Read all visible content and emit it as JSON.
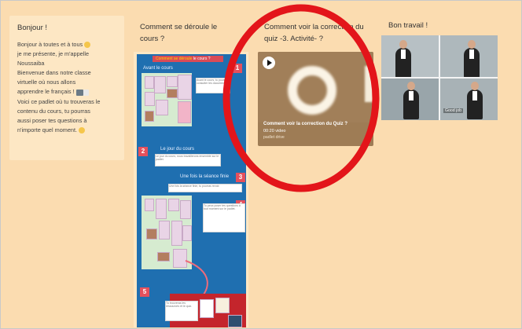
{
  "column1": {
    "title": "Bonjour !",
    "lines": [
      "Bonjour à toutes et à tous",
      "je me présente, je m'appelle",
      "Noussaiba",
      "Bienvenue dans notre classe",
      "virtuelle où nous allons",
      "apprendre le français !",
      "Voici ce padlet où tu trouveras le",
      "contenu du cours, tu pourras",
      "aussi poser tes questions à",
      "n'importe quel moment."
    ]
  },
  "column2": {
    "title": "Comment se déroule le cours ?",
    "board": {
      "header_prefix": "Comment se déroule",
      "header_suffix": "le cours ?",
      "sections": [
        "Avant le cours",
        "Le jour du cours",
        "Une fois la séance finie"
      ],
      "numbers": [
        "1",
        "2",
        "3",
        "4",
        "5"
      ]
    }
  },
  "column3": {
    "title": "Comment voir la correction du quiz -3. Activité- ?",
    "video": {
      "title": "Comment voir la correction du Quiz ?",
      "subtitle": "00:20 video",
      "source": "padlet drive"
    }
  },
  "column4": {
    "title": "Bon travail !",
    "captions": [
      "Good job"
    ]
  },
  "colors": {
    "background": "#fbdcb0",
    "card": "#fde7c4",
    "board": "#1f6fb0",
    "highlight_circle": "#e3151a"
  }
}
